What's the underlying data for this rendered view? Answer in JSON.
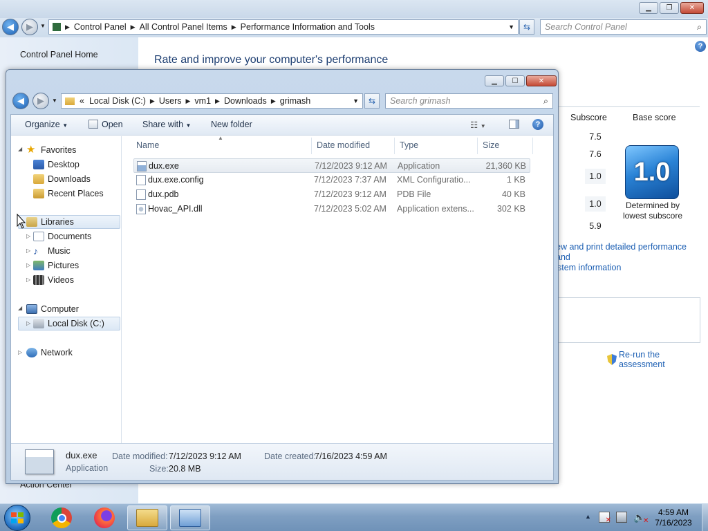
{
  "control_panel": {
    "breadcrumb": [
      "Control Panel",
      "All Control Panel Items",
      "Performance Information and Tools"
    ],
    "search_placeholder": "Search Control Panel",
    "home_link": "Control Panel Home",
    "action_center": "Action Center",
    "title": "Rate and improve your computer's performance",
    "subscore_header": "Subscore",
    "basescore_header": "Base score",
    "subscores": [
      "7.5",
      "7.6",
      "1.0",
      "1.0",
      "5.9"
    ],
    "base_score": "1.0",
    "base_caption_1": "Determined by",
    "base_caption_2": "lowest subscore",
    "print_link_1": "ew and print detailed performance and",
    "print_link_2": "stem information",
    "rerun": "Re-run the assessment"
  },
  "explorer": {
    "breadcrumb_prefix": "«",
    "breadcrumb": [
      "Local Disk (C:)",
      "Users",
      "vm1",
      "Downloads",
      "grimash"
    ],
    "search_placeholder": "Search grimash",
    "toolbar": {
      "organize": "Organize",
      "open": "Open",
      "share_with": "Share with",
      "new_folder": "New folder"
    },
    "nav": {
      "favorites": "Favorites",
      "desktop": "Desktop",
      "downloads": "Downloads",
      "recent_places": "Recent Places",
      "libraries": "Libraries",
      "documents": "Documents",
      "music": "Music",
      "pictures": "Pictures",
      "videos": "Videos",
      "computer": "Computer",
      "local_disk": "Local Disk (C:)",
      "network": "Network"
    },
    "columns": [
      "Name",
      "Date modified",
      "Type",
      "Size"
    ],
    "files": [
      {
        "name": "dux.exe",
        "date": "7/12/2023 9:12 AM",
        "type": "Application",
        "size": "21,360 KB"
      },
      {
        "name": "dux.exe.config",
        "date": "7/12/2023 7:37 AM",
        "type": "XML Configuratio...",
        "size": "1 KB"
      },
      {
        "name": "dux.pdb",
        "date": "7/12/2023 9:12 AM",
        "type": "PDB File",
        "size": "40 KB"
      },
      {
        "name": "Hovac_API.dll",
        "date": "7/12/2023 5:02 AM",
        "type": "Application extens...",
        "size": "302 KB"
      }
    ],
    "details": {
      "name": "dux.exe",
      "kind": "Application",
      "modified_label": "Date modified:",
      "modified_value": "7/12/2023 9:12 AM",
      "created_label": "Date created:",
      "created_value": "7/16/2023 4:59 AM",
      "size_label": "Size:",
      "size_value": "20.8 MB"
    }
  },
  "taskbar": {
    "time": "4:59 AM",
    "date": "7/16/2023"
  },
  "colors": {
    "accent": "#1c5fb3",
    "title_text": "#1e3f72",
    "close_button": "#c44a36"
  }
}
